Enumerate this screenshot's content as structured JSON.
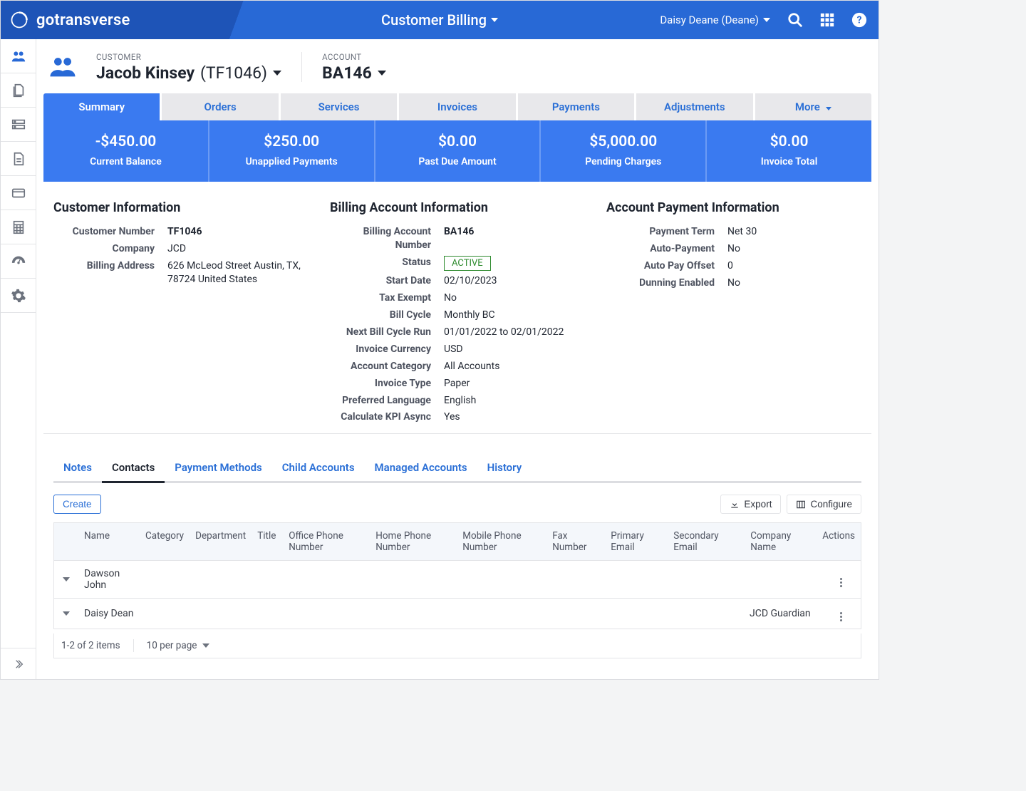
{
  "brand": "gotransverse",
  "app_title": "Customer Billing",
  "user": {
    "display": "Daisy Deane (Deane)"
  },
  "sidebar": [
    {
      "name": "customers-icon",
      "active": true
    },
    {
      "name": "documents-icon"
    },
    {
      "name": "data-icon"
    },
    {
      "name": "file-icon"
    },
    {
      "name": "billing-icon"
    },
    {
      "name": "calculator-icon"
    },
    {
      "name": "gauge-icon"
    },
    {
      "name": "gear-icon"
    }
  ],
  "heading": {
    "customer_label": "CUSTOMER",
    "customer_name": "Jacob Kinsey",
    "customer_code": "(TF1046)",
    "account_label": "ACCOUNT",
    "account_value": "BA146"
  },
  "tabs": {
    "items": [
      "Summary",
      "Orders",
      "Services",
      "Invoices",
      "Payments",
      "Adjustments"
    ],
    "more": "More",
    "active": "Summary"
  },
  "metrics": [
    {
      "value": "-$450.00",
      "label": "Current Balance"
    },
    {
      "value": "$250.00",
      "label": "Unapplied Payments"
    },
    {
      "value": "$0.00",
      "label": "Past Due Amount"
    },
    {
      "value": "$5,000.00",
      "label": "Pending Charges"
    },
    {
      "value": "$0.00",
      "label": "Invoice Total"
    }
  ],
  "customer_info": {
    "title": "Customer Information",
    "rows": [
      {
        "k": "Customer Number",
        "v": "TF1046",
        "bold": true
      },
      {
        "k": "Company",
        "v": "JCD"
      },
      {
        "k": "Billing Address",
        "v": "626 McLeod Street Austin, TX, 78724 United States"
      }
    ]
  },
  "billing_info": {
    "title": "Billing Account Information",
    "rows": [
      {
        "k": "Billing Account Number",
        "v": "BA146",
        "bold": true
      },
      {
        "k": "Status",
        "v": "ACTIVE",
        "badge": true
      },
      {
        "k": "Start Date",
        "v": "02/10/2023"
      },
      {
        "k": "Tax Exempt",
        "v": "No"
      },
      {
        "k": "Bill Cycle",
        "v": "Monthly BC"
      },
      {
        "k": "Next Bill Cycle Run",
        "v": "01/01/2022 to 02/01/2022"
      },
      {
        "k": "Invoice Currency",
        "v": "USD"
      },
      {
        "k": "Account Category",
        "v": "All Accounts"
      },
      {
        "k": "Invoice Type",
        "v": "Paper"
      },
      {
        "k": "Preferred Language",
        "v": "English"
      },
      {
        "k": "Calculate KPI Async",
        "v": "Yes"
      }
    ]
  },
  "payment_info": {
    "title": "Account Payment Information",
    "rows": [
      {
        "k": "Payment Term",
        "v": "Net 30"
      },
      {
        "k": "Auto-Payment",
        "v": "No"
      },
      {
        "k": "Auto Pay Offset",
        "v": "0"
      },
      {
        "k": "Dunning Enabled",
        "v": "No"
      }
    ]
  },
  "subtabs": {
    "items": [
      "Notes",
      "Contacts",
      "Payment Methods",
      "Child Accounts",
      "Managed Accounts",
      "History"
    ],
    "active": "Contacts"
  },
  "contacts": {
    "create": "Create",
    "export": "Export",
    "configure": "Configure",
    "columns": [
      "Name",
      "Category",
      "Department",
      "Title",
      "Office Phone Number",
      "Home Phone Number",
      "Mobile Phone Number",
      "Fax Number",
      "Primary Email",
      "Secondary Email",
      "Company Name",
      "Actions"
    ],
    "rows": [
      {
        "name": "Dawson John",
        "category": "",
        "department": "",
        "title": "",
        "ophone": "",
        "hphone": "",
        "mphone": "",
        "fax": "",
        "pemail": "",
        "semail": "",
        "company": ""
      },
      {
        "name": "Daisy Dean",
        "category": "",
        "department": "",
        "title": "",
        "ophone": "",
        "hphone": "",
        "mphone": "",
        "fax": "",
        "pemail": "",
        "semail": "",
        "company": "JCD Guardian"
      }
    ],
    "footer_left": "1-2 of 2 items",
    "footer_pp": "10 per page"
  }
}
